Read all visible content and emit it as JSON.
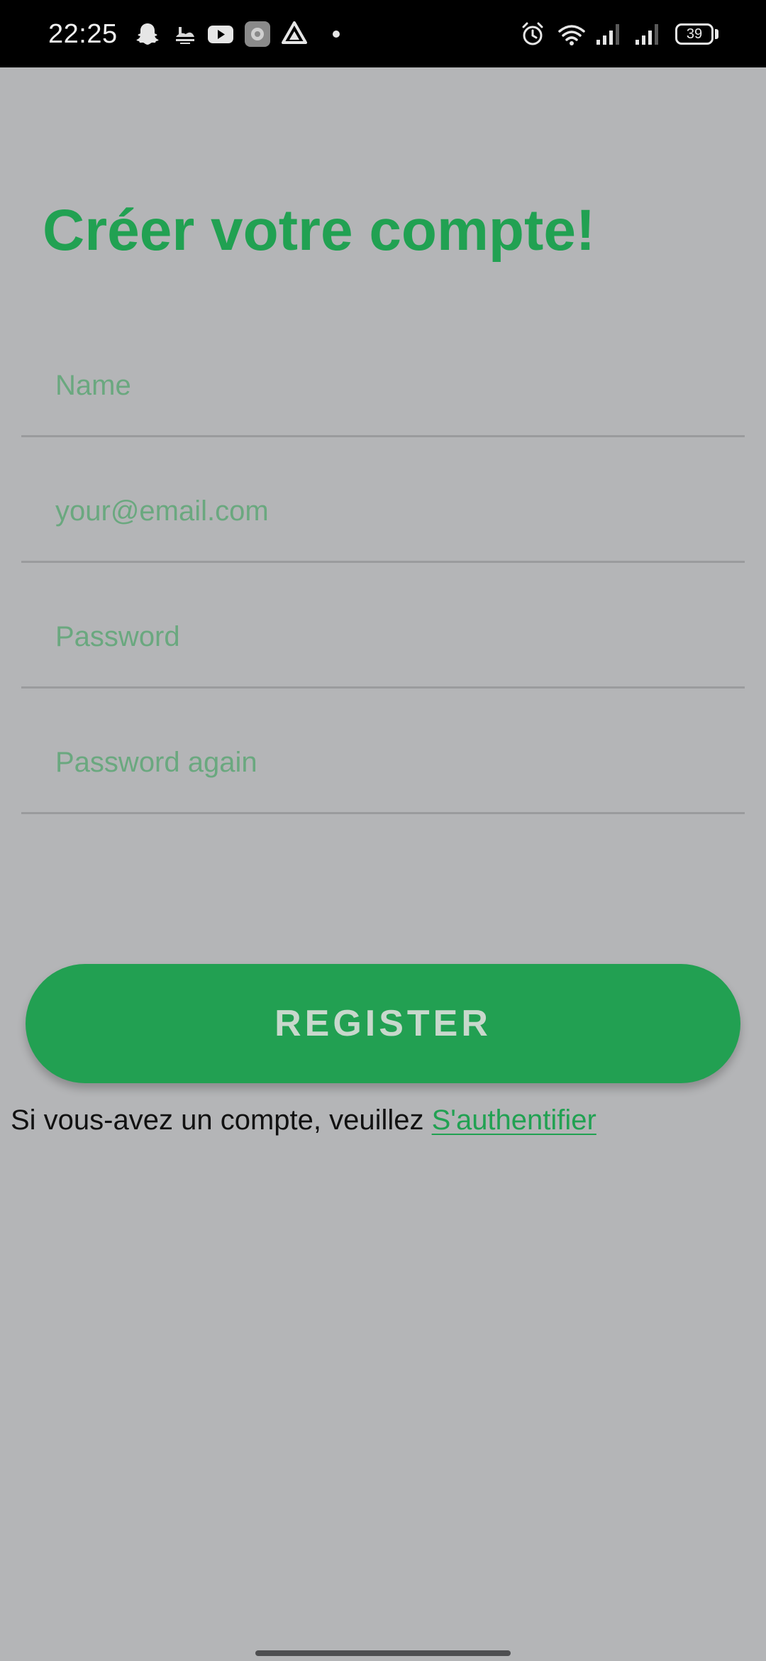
{
  "status_bar": {
    "time": "22:25",
    "notification_icons": [
      "snapchat-icon",
      "weather-icon",
      "youtube-icon",
      "settings-app-icon",
      "drive-icon",
      "dot-icon"
    ],
    "system_icons": [
      "alarm-icon",
      "wifi-icon",
      "signal-icon",
      "signal-icon",
      "battery-icon"
    ],
    "battery_level": "39"
  },
  "page": {
    "title": "Créer votre compte!"
  },
  "form": {
    "name_placeholder": "Name",
    "email_placeholder": "your@email.com",
    "password_placeholder": "Password",
    "password_again_placeholder": "Password again"
  },
  "register_button_label": "REGISTER",
  "login_prompt": {
    "text": "Si vous-avez un compte, veuillez",
    "link_label": "S'authentifier"
  },
  "colors": {
    "accent": "#21a152",
    "background": "#b4b5b7",
    "placeholder": "#6aa87f",
    "status_bar": "#000000"
  }
}
